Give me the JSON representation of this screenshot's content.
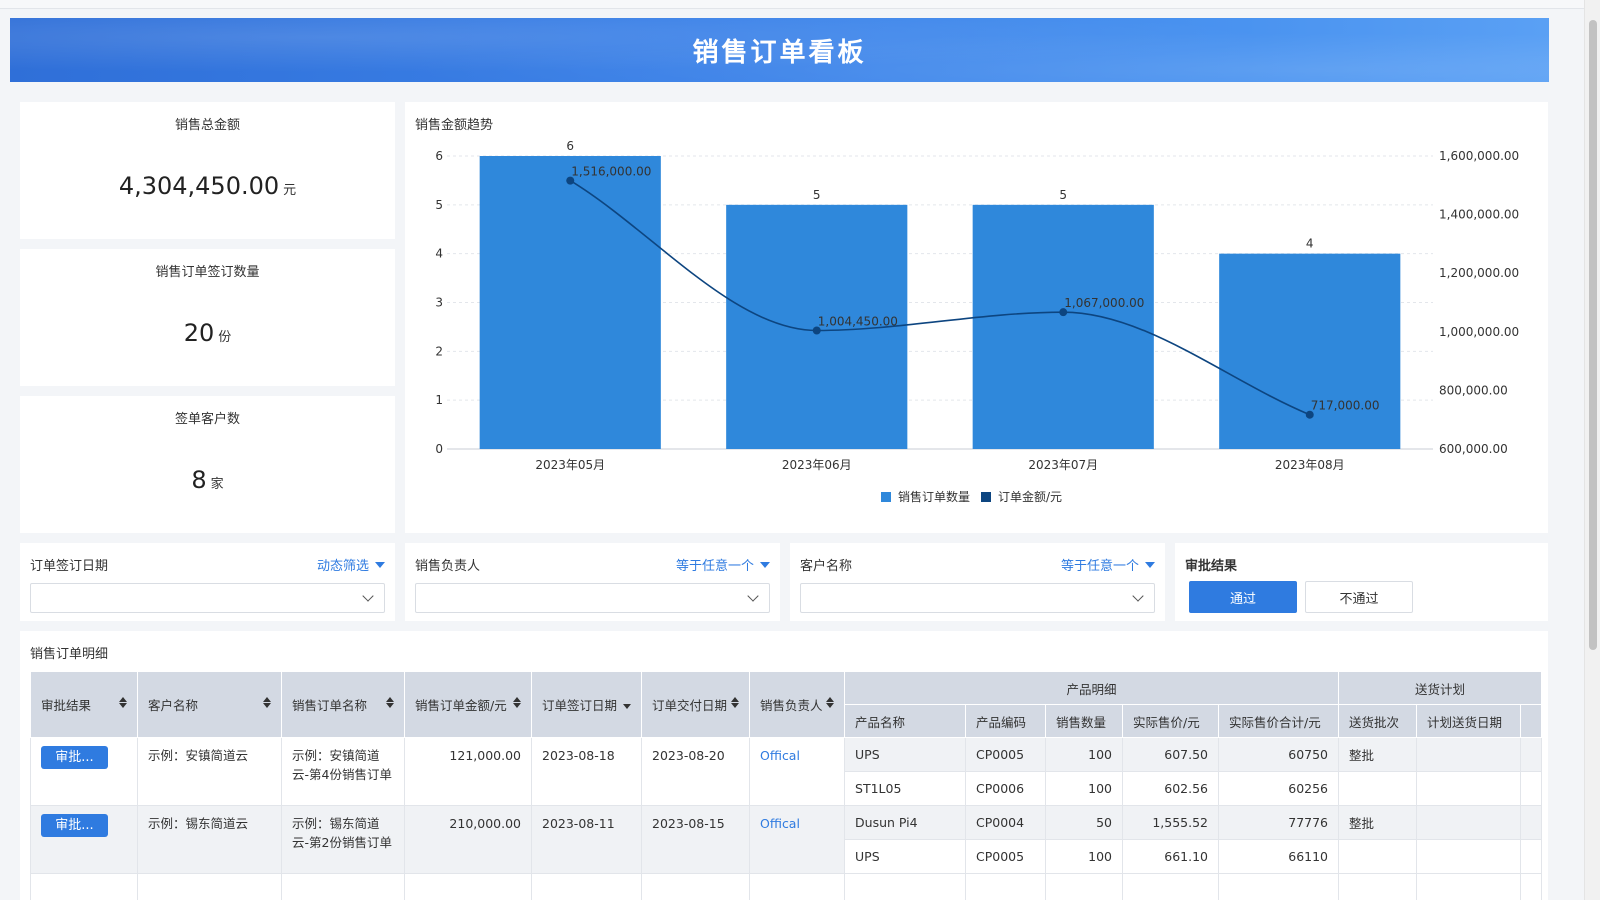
{
  "page_title": "销售订单看板",
  "kpis": [
    {
      "label": "销售总金额",
      "value": "4,304,450.00",
      "unit": "元"
    },
    {
      "label": "销售订单签订数量",
      "value": "20",
      "unit": "份"
    },
    {
      "label": "签单客户数",
      "value": "8",
      "unit": "家"
    }
  ],
  "chart_title": "销售金额趋势",
  "chart_data": {
    "type": "bar",
    "categories": [
      "2023年05月",
      "2023年06月",
      "2023年07月",
      "2023年08月"
    ],
    "series": [
      {
        "name": "销售订单数量",
        "type": "bar",
        "axis": "left",
        "values": [
          6,
          5,
          5,
          4
        ],
        "color": "#2f88db"
      },
      {
        "name": "订单金额/元",
        "type": "line",
        "axis": "right",
        "values": [
          1516000,
          1004450,
          1067000,
          717000
        ],
        "labels": [
          "1,516,000.00",
          "1,004,450.00",
          "1,067,000.00",
          "717,000.00"
        ],
        "color": "#0d4580"
      }
    ],
    "y_left": {
      "range": [
        0,
        6
      ],
      "ticks": [
        "0",
        "1",
        "2",
        "3",
        "4",
        "5",
        "6"
      ]
    },
    "y_right": {
      "range": [
        600000,
        1600000
      ],
      "ticks": [
        "600,000.00",
        "800,000.00",
        "1,000,000.00",
        "1,200,000.00",
        "1,400,000.00",
        "1,600,000.00"
      ]
    },
    "grid": true,
    "legend_position": "bottom"
  },
  "filters": [
    {
      "label": "订单签订日期",
      "mode": "动态筛选"
    },
    {
      "label": "销售负责人",
      "mode": "等于任意一个"
    },
    {
      "label": "客户名称",
      "mode": "等于任意一个"
    }
  ],
  "approval": {
    "title": "审批结果",
    "pass": "通过",
    "fail": "不通过"
  },
  "table": {
    "title": "销售订单明细",
    "headers": {
      "approval": "审批结果",
      "customer": "客户名称",
      "order_name": "销售订单名称",
      "amount": "销售订单金额/元",
      "sign_date": "订单签订日期",
      "delivery_date": "订单交付日期",
      "owner": "销售负责人",
      "product_group": "产品明细",
      "product_name": "产品名称",
      "product_code": "产品编码",
      "qty": "销售数量",
      "price": "实际售价/元",
      "total": "实际售价合计/元",
      "delivery_group": "送货计划",
      "batch": "送货批次",
      "plan_date": "计划送货日期"
    },
    "orders": [
      {
        "approval": "审批...",
        "customer": "示例：安镇简道云",
        "order_name": "示例：安镇简道云-第4份销售订单",
        "amount": "121,000.00",
        "sign_date": "2023-08-18",
        "delivery_date": "2023-08-20",
        "owner": "Offical",
        "products": [
          {
            "name": "UPS",
            "code": "CP0005",
            "qty": "100",
            "price": "607.50",
            "total": "60750",
            "batch": "整批",
            "plan_date": ""
          },
          {
            "name": "ST1L05",
            "code": "CP0006",
            "qty": "100",
            "price": "602.56",
            "total": "60256",
            "batch": "",
            "plan_date": ""
          }
        ]
      },
      {
        "approval": "审批...",
        "customer": "示例：锡东简道云",
        "order_name": "示例：锡东简道云-第2份销售订单",
        "amount": "210,000.00",
        "sign_date": "2023-08-11",
        "delivery_date": "2023-08-15",
        "owner": "Offical",
        "products": [
          {
            "name": "Dusun Pi4",
            "code": "CP0004",
            "qty": "50",
            "price": "1,555.52",
            "total": "77776",
            "batch": "整批",
            "plan_date": ""
          },
          {
            "name": "UPS",
            "code": "CP0005",
            "qty": "100",
            "price": "661.10",
            "total": "66110",
            "batch": "",
            "plan_date": ""
          }
        ]
      }
    ]
  }
}
